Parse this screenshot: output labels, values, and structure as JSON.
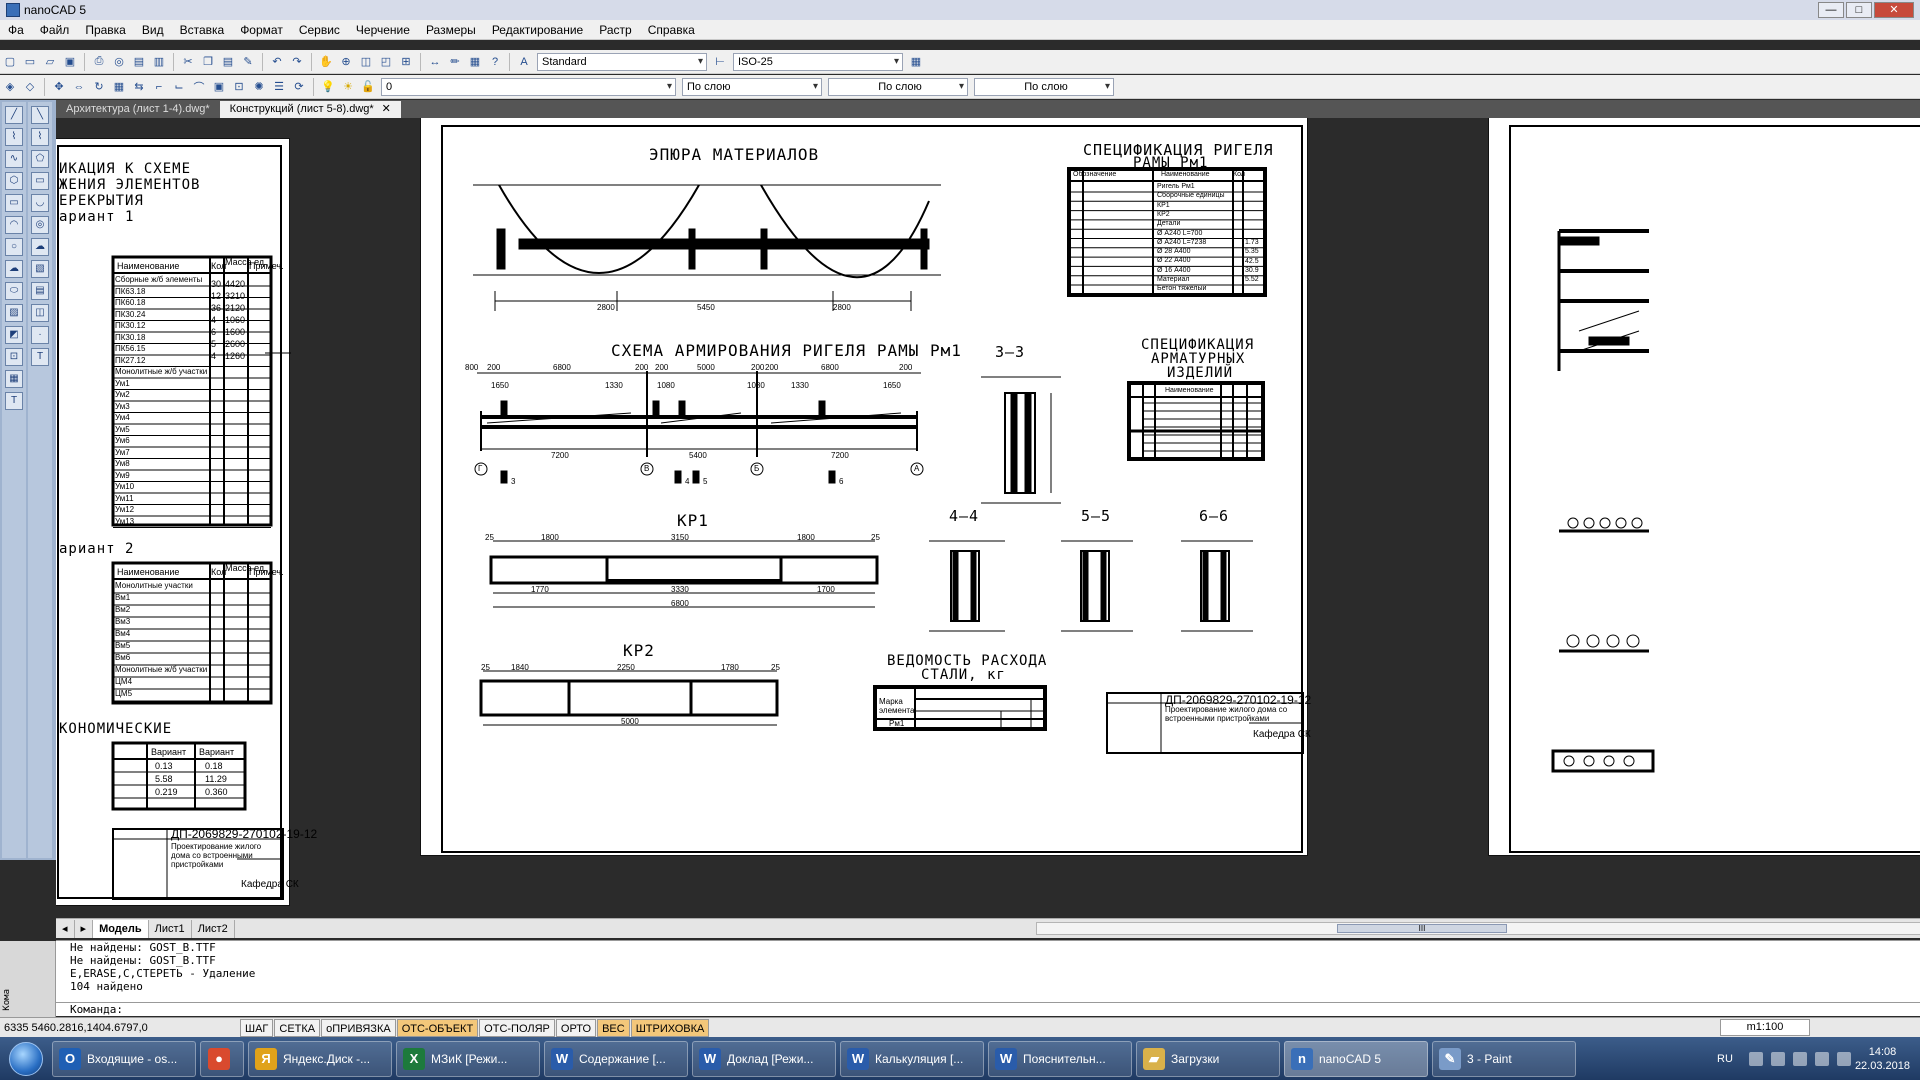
{
  "app": {
    "title": "nanoCAD 5",
    "title_prefix": "n"
  },
  "menu": [
    "Фа",
    "Файл",
    "Правка",
    "Вид",
    "Вставка",
    "Формат",
    "Сервис",
    "Черчение",
    "Размеры",
    "Редактирование",
    "Растр",
    "Справка"
  ],
  "toolbar": {
    "text_style": "Standard",
    "dim_style": "ISO-25",
    "layer": "0",
    "color": "По слою",
    "linetype": "По слою",
    "lineweight": "По слою"
  },
  "doc_tabs": [
    {
      "label": "Архитектура (лист 1-4).dwg*",
      "active": false
    },
    {
      "label": "Конструкций (лист 5-8).dwg*",
      "active": true,
      "close": "✕"
    }
  ],
  "drawing": {
    "left_sheet": {
      "title_lines": [
        "ИКАЦИЯ К СХЕМЕ",
        "ЖЕНИЯ ЭЛЕМЕНТОВ",
        "ЕРЕКРЫТИЯ",
        "ариант 1"
      ],
      "variant2": "ариант 2",
      "economic": "КОНОМИЧЕСКИЕ",
      "table_headers": [
        "Наименование",
        "Кол",
        "Масса ед.",
        "Примеч."
      ],
      "rows1": [
        "Сборные ж/б элементы",
        "ПК63.18",
        "ПК60.18",
        "ПК30.24",
        "ПК30.12",
        "ПК30.18",
        "ПК56.15",
        "ПК27.12",
        "Монолитные ж/б участки",
        "Ум1",
        "Ум2",
        "Ум3",
        "Ум4",
        "Ум5",
        "Ум6",
        "Ум7",
        "Ум8",
        "Ум9",
        "Ум10",
        "Ум11",
        "Ум12",
        "Ум13"
      ],
      "rows2": [
        "Монолитные участки",
        "Вм1",
        "Вм2",
        "Вм3",
        "Вм4",
        "Вм5",
        "Вм6",
        "Монолитные ж/б участки",
        "ЦМ4",
        "ЦМ5"
      ],
      "econ_headers": [
        "Вариант",
        "Вариант"
      ],
      "econ_values": [
        "0.13",
        "0.18",
        "5.58",
        "11.29",
        "0.219",
        "0.360"
      ],
      "stamp_code": "ДП-2069829-270102-19-12",
      "stamp_text": "Проектирование жилого дома со встроенными пристройками",
      "stamp_dept": "Кафедра СК",
      "counts": [
        "30",
        "12",
        "36",
        "4",
        "6",
        "5",
        "4"
      ],
      "masses": [
        "4420",
        "3210",
        "2120",
        "1060",
        "1600",
        "2600",
        "1260"
      ]
    },
    "center_sheet": {
      "epura_title": "ЭПЮРА МАТЕРИАЛОВ",
      "spec_rigel_title": [
        "СПЕЦИФИКАЦИЯ РИГЕЛЯ",
        "РАМЫ Рм1"
      ],
      "spec_rigel_headers": [
        "Обозначение",
        "Наименование",
        "Кол"
      ],
      "spec_rigel_rows": [
        "Ригель Рм1",
        "Сборочные единицы",
        "КР1",
        "КР2",
        "Детали",
        "Ø А240 L=700",
        "Ø А240 L=7238",
        "Ø 28 А400",
        "Ø 22 А400",
        "Ø 16 А400",
        "Материал",
        "Бетон тяжелый"
      ],
      "spec_rigel_values": [
        "1.73",
        "5.35",
        "42.5",
        "30.9",
        "5.52"
      ],
      "armir_title": "СХЕМА АРМИРОВАНИЯ РИГЕЛЯ РАМЫ Рм1",
      "armir_dims_top": [
        "800",
        "200",
        "6800",
        "200",
        "200",
        "5000",
        "200",
        "200",
        "6800",
        "200"
      ],
      "armir_dims_mid": [
        "1650",
        "1330",
        "1080",
        "1080",
        "1330",
        "1650"
      ],
      "armir_dims_bot": [
        "7200",
        "5400",
        "7200"
      ],
      "axes": [
        "Г",
        "В",
        "Б",
        "А"
      ],
      "marks": [
        "3",
        "4",
        "5",
        "6"
      ],
      "spec_arm_title": [
        "СПЕЦИФИКАЦИЯ",
        "АРМАТУРНЫХ",
        "ИЗДЕЛИЙ"
      ],
      "spec_arm_headers": [
        "Наименование"
      ],
      "kr1_title": "КР1",
      "kr1_dims": [
        "25",
        "1800",
        "3150",
        "1800",
        "25",
        "1770",
        "3330",
        "1700",
        "6800"
      ],
      "kr2_title": "КР2",
      "kr2_dims": [
        "25",
        "1840",
        "2250",
        "1780",
        "25",
        "5000"
      ],
      "sec_3": "3–3",
      "sec_4": "4–4",
      "sec_5": "5–5",
      "sec_6": "6–6",
      "vedomost_title": [
        "ВЕДОМОСТЬ РАСХОДА",
        "СТАЛИ, кг"
      ],
      "vedomost_col": "Марка элемента",
      "vedomost_row": "Рм1",
      "stamp_code": "ДП-2069829-270102-19-12",
      "stamp_text": "Проектирование жилого дома со встроенными пристройками",
      "stamp_dept": "Кафедра СК",
      "span_dims": [
        "2800",
        "5450",
        "2800"
      ]
    }
  },
  "layout_tabs": [
    "Модель",
    "Лист1",
    "Лист2"
  ],
  "layout_nav": [
    "◂",
    "▸"
  ],
  "scroll_mark": "III",
  "command": {
    "history": [
      "Не найдены: GOST_B.TTF",
      "Не найдены: GOST_B.TTF",
      "E,ERASE,С,СТЕРЕТЬ - Удаление",
      "104 найдено"
    ],
    "prompt": "Команда:",
    "side_label": "Кома"
  },
  "status": {
    "coords": "6335 5460.2816,1404.6797,0",
    "buttons": [
      {
        "label": "ШАГ",
        "on": false
      },
      {
        "label": "СЕТКА",
        "on": false
      },
      {
        "label": "оПРИВЯЗКА",
        "on": false
      },
      {
        "label": "ОТС-ОБЪЕКТ",
        "on": true
      },
      {
        "label": "ОТС-ПОЛЯР",
        "on": false
      },
      {
        "label": "ОРТО",
        "on": false
      },
      {
        "label": "ВЕС",
        "on": true
      },
      {
        "label": "ШТРИХОВКА",
        "on": true
      }
    ],
    "scale": "m1:100"
  },
  "taskbar": {
    "items": [
      {
        "label": "Входящие - os...",
        "icon": "O",
        "color": "#1f5fb4"
      },
      {
        "label": "",
        "icon": "●",
        "color": "#d94a2e",
        "pinned": true
      },
      {
        "label": "Яндекс.Диск -...",
        "icon": "Я",
        "color": "#e0a21a"
      },
      {
        "label": "МЗиК  [Режи...",
        "icon": "X",
        "color": "#1d7a3c"
      },
      {
        "label": "Содержание [...",
        "icon": "W",
        "color": "#2a5caa"
      },
      {
        "label": "Доклад [Режи...",
        "icon": "W",
        "color": "#2a5caa"
      },
      {
        "label": "Калькуляция [...",
        "icon": "W",
        "color": "#2a5caa"
      },
      {
        "label": "Пояснительн...",
        "icon": "W",
        "color": "#2a5caa"
      },
      {
        "label": "Загрузки",
        "icon": "▰",
        "color": "#d9b14a"
      },
      {
        "label": "nanoCAD 5",
        "icon": "n",
        "color": "#3a6fb8",
        "active": true
      },
      {
        "label": "3 - Paint",
        "icon": "✎",
        "color": "#7a9bc8"
      }
    ],
    "lang": "RU",
    "time": "14:08",
    "date": "22.03.2018"
  }
}
